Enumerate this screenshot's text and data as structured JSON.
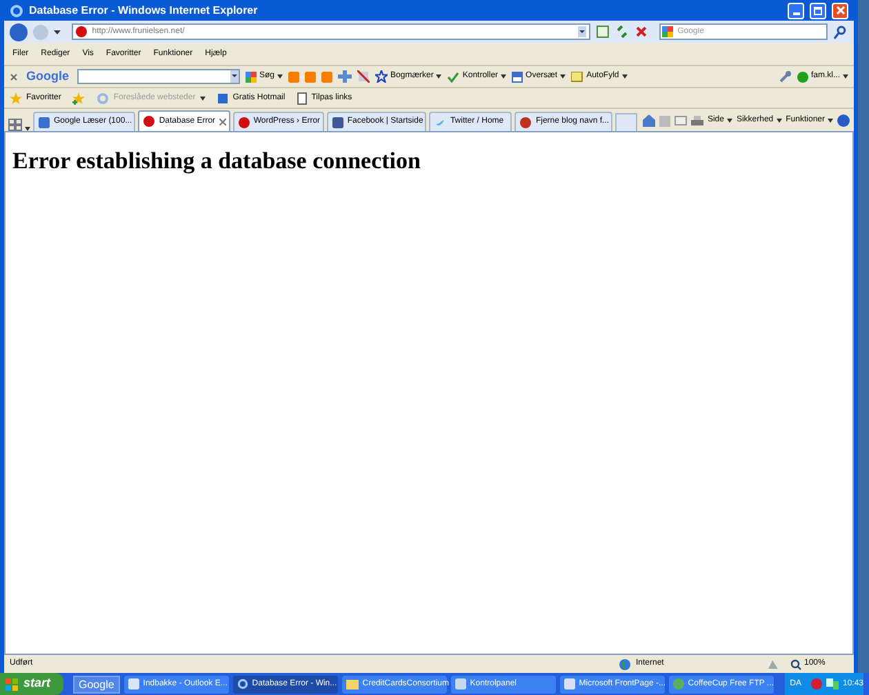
{
  "window": {
    "title": "Database Error - Windows Internet Explorer"
  },
  "address_bar": {
    "url": "http://www.frunielsen.net/"
  },
  "search": {
    "placeholder": "Google"
  },
  "menu": [
    "Filer",
    "Rediger",
    "Vis",
    "Favoritter",
    "Funktioner",
    "Hjælp"
  ],
  "google_toolbar": {
    "logo": "Google",
    "left_items": [
      "Søg",
      "Bogmærker",
      "Kontroller",
      "Oversæt",
      "AutoFyld"
    ],
    "account": "fam.kl..."
  },
  "favorites_bar": [
    {
      "label": "Favoritter",
      "disabled": false
    },
    {
      "label": "Foreslåede websteder",
      "disabled": true
    },
    {
      "label": "Gratis Hotmail",
      "disabled": false
    },
    {
      "label": "Tilpas links",
      "disabled": false
    }
  ],
  "tabs": [
    {
      "label": "Google Læser (100...",
      "selected": false
    },
    {
      "label": "Database Error",
      "selected": true
    },
    {
      "label": "WordPress › Error",
      "selected": false
    },
    {
      "label": "Facebook | Startside",
      "selected": false
    },
    {
      "label": "Twitter / Home",
      "selected": false
    },
    {
      "label": "Fjerne blog navn f...",
      "selected": false
    }
  ],
  "command_bar": [
    "Side",
    "Sikkerhed",
    "Funktioner"
  ],
  "content": {
    "heading": "Error establishing a database connection"
  },
  "status_bar": {
    "status": "Udført",
    "zone": "Internet",
    "zoom": "100%"
  },
  "taskbar": {
    "start": "start",
    "google": "Google",
    "tasks": [
      {
        "label": "Indbakke - Outlook E...",
        "selected": false
      },
      {
        "label": "Database Error - Win...",
        "selected": true
      },
      {
        "label": "CreditCardsConsortium",
        "selected": false
      },
      {
        "label": "Kontrolpanel",
        "selected": false
      },
      {
        "label": "Microsoft FrontPage -...",
        "selected": false
      },
      {
        "label": "CoffeeCup Free FTP ...",
        "selected": false
      }
    ],
    "language": "DA",
    "clock": "10:43"
  }
}
